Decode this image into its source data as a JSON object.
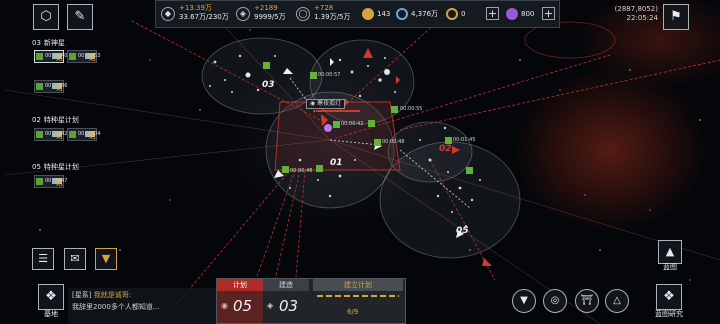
{
  "resources": [
    {
      "icon": "metal-icon",
      "delta": "+13.39万",
      "value": "33.67万/230万"
    },
    {
      "icon": "crystal-icon",
      "delta": "+2189",
      "value": "9999/5万"
    },
    {
      "icon": "gas-icon",
      "delta": "+728",
      "value": "1.39万/5万"
    }
  ],
  "currencies": [
    {
      "icon": "fuel-icon",
      "value": "143",
      "color": "#d6a342"
    },
    {
      "icon": "credit-icon",
      "value": "4,376万",
      "color": "#6aa8d8"
    },
    {
      "icon": "coin-icon",
      "value": "0",
      "color": "#d6a342"
    },
    {
      "icon": "gem-icon",
      "value": "800",
      "color": "#9a5ad8"
    }
  ],
  "coords": {
    "position": "(2887,8052)",
    "time": "22:05:24"
  },
  "fleets": {
    "group1": {
      "num": "03",
      "name": "新神星",
      "slots": [
        "00:01:40",
        "00:02:53",
        "00:01:36"
      ]
    },
    "group2": {
      "num": "02",
      "name": "特种星计划",
      "slots": [
        "00:02:42",
        "00:26:04"
      ]
    },
    "group3": {
      "num": "05",
      "name": "特种星计划",
      "slots": [
        "00:00:47"
      ]
    }
  },
  "map": {
    "target_name": "寒夜孤灯",
    "labels": [
      "00:00:57",
      "00:00:55",
      "00:00:42",
      "00:00:48",
      "00:00:48",
      "00:01:45",
      "00:02:45",
      "00:00:48"
    ],
    "numbers": [
      "03",
      "01",
      "02",
      "05"
    ]
  },
  "chat": {
    "channel": "[星系]",
    "speaker": "我就是诚哥:",
    "message": "我辞里2000多个人都知道..."
  },
  "plan": {
    "tab_plan": "计划",
    "tab_build": "建造",
    "create": "建立计划",
    "plan_count": "05",
    "build_count": "03",
    "progress": "6/9"
  },
  "bottom": {
    "base": "基地",
    "blueprint": "蓝图",
    "research": "蓝图研究"
  },
  "colors": {
    "accent": "#c0302c",
    "gold": "#d6a342",
    "green": "#63b23b"
  }
}
